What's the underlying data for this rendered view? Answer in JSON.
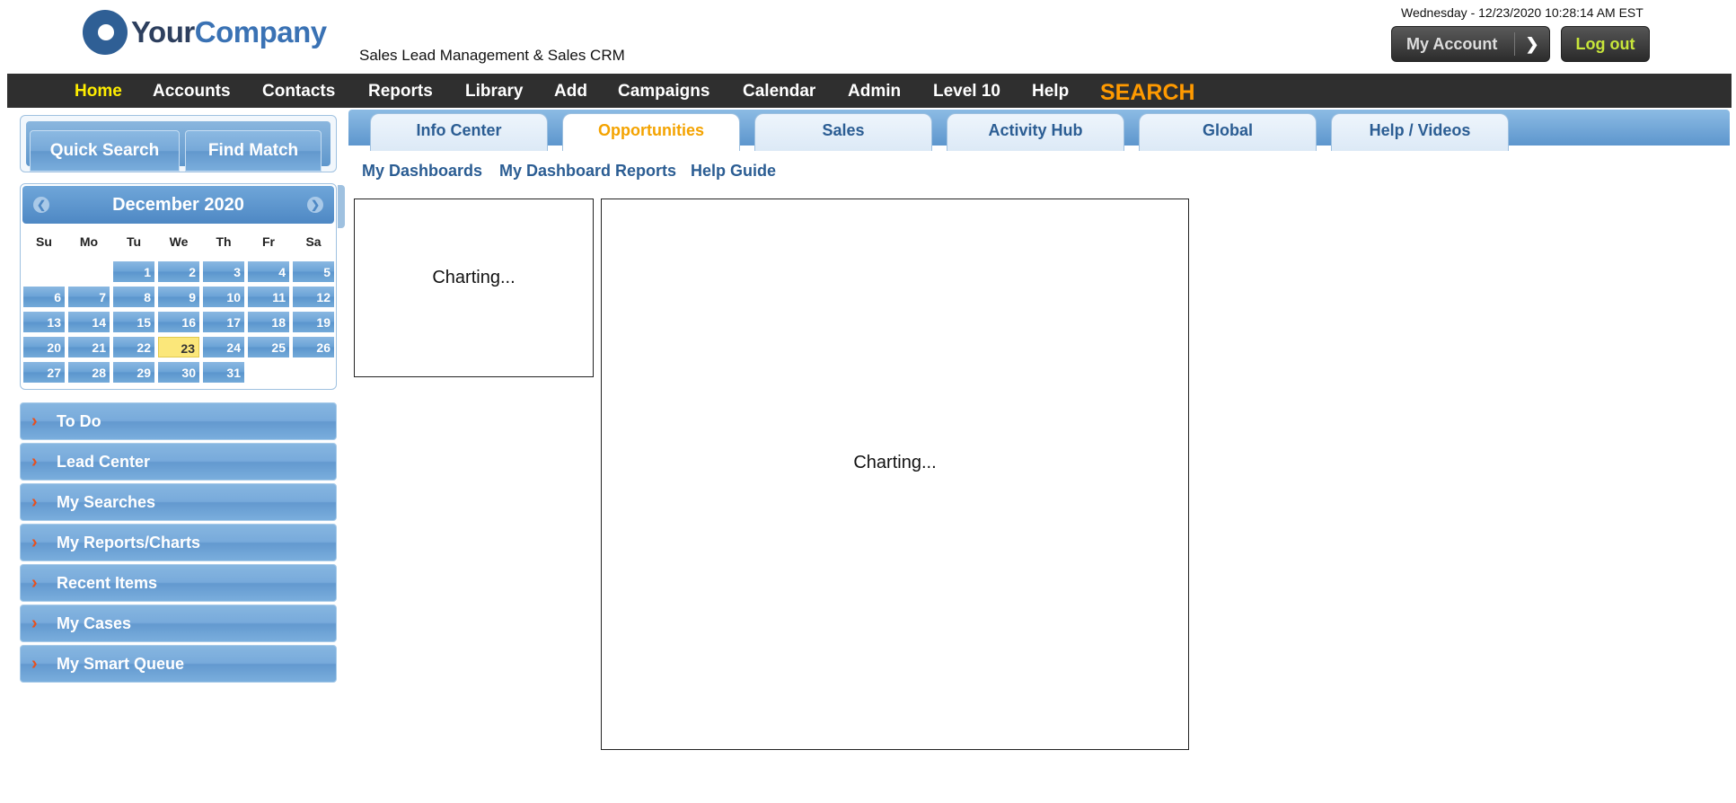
{
  "header": {
    "logo_your": "Your",
    "logo_company": "Company",
    "subtitle": "Sales Lead Management & Sales CRM",
    "datetime": "Wednesday - 12/23/2020 10:28:14 AM EST",
    "my_account_label": "My Account",
    "logout_label": "Log out"
  },
  "nav": {
    "home": "Home",
    "accounts": "Accounts",
    "contacts": "Contacts",
    "reports": "Reports",
    "library": "Library",
    "add": "Add",
    "campaigns": "Campaigns",
    "calendar": "Calendar",
    "admin": "Admin",
    "level10": "Level 10",
    "help": "Help",
    "search": "SEARCH"
  },
  "sidebar": {
    "quick_search": "Quick Search",
    "find_match": "Find Match",
    "calendar": {
      "month": "December 2020",
      "dow": [
        "Su",
        "Mo",
        "Tu",
        "We",
        "Th",
        "Fr",
        "Sa"
      ],
      "days": [
        "1",
        "2",
        "3",
        "4",
        "5",
        "6",
        "7",
        "8",
        "9",
        "10",
        "11",
        "12",
        "13",
        "14",
        "15",
        "16",
        "17",
        "18",
        "19",
        "20",
        "21",
        "22",
        "23",
        "24",
        "25",
        "26",
        "27",
        "28",
        "29",
        "30",
        "31"
      ],
      "today": "23"
    },
    "items": [
      {
        "label": "To Do"
      },
      {
        "label": "Lead Center"
      },
      {
        "label": "My Searches"
      },
      {
        "label": "My Reports/Charts"
      },
      {
        "label": "Recent Items"
      },
      {
        "label": "My Cases"
      },
      {
        "label": "My Smart Queue"
      }
    ]
  },
  "tabs": [
    {
      "label": "Info Center"
    },
    {
      "label": "Opportunities"
    },
    {
      "label": "Sales"
    },
    {
      "label": "Activity Hub"
    },
    {
      "label": "Global"
    },
    {
      "label": "Help / Videos"
    }
  ],
  "sublinks": {
    "my_dashboards": "My Dashboards",
    "my_dashboard_reports": "My Dashboard Reports",
    "help_guide": "Help Guide"
  },
  "charts": {
    "small_text": "Charting...",
    "large_text": "Charting..."
  }
}
